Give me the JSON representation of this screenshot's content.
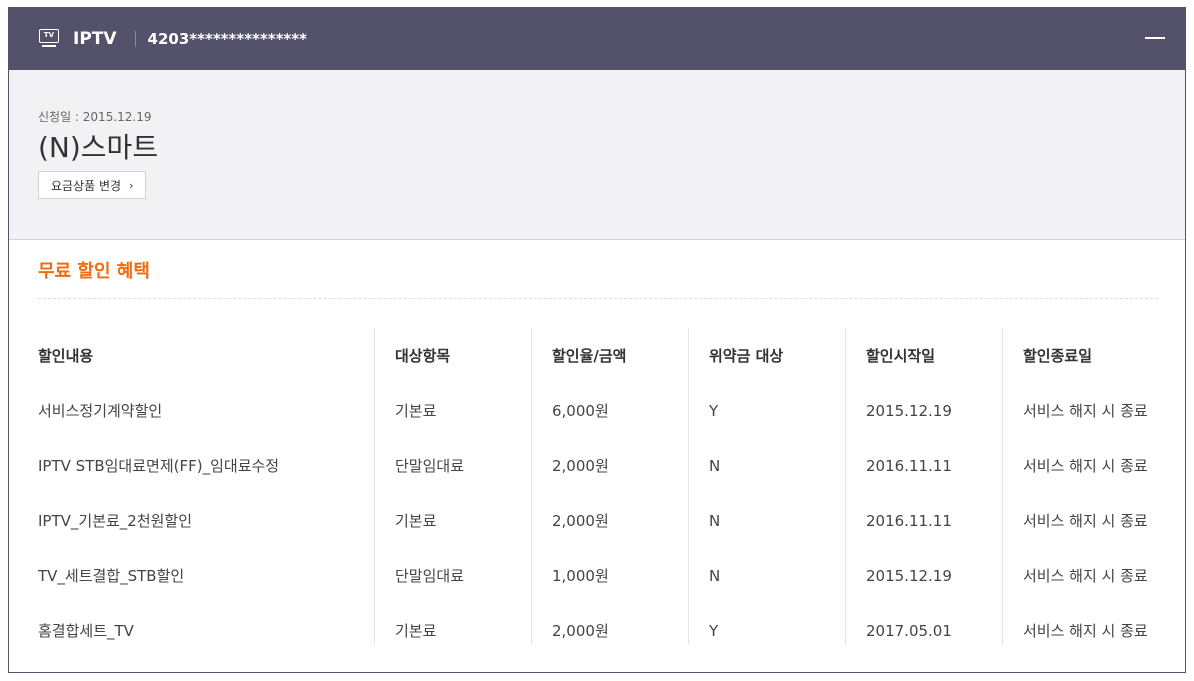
{
  "header": {
    "tv_icon_label": "TV",
    "service_name": "IPTV",
    "account_number": "4203***************"
  },
  "plan": {
    "apply_date": "신청일 : 2015.12.19",
    "name": "(N)스마트",
    "change_button_label": "요금상품 변경",
    "change_button_chevron": "›"
  },
  "benefits": {
    "title": "무료 할인 혜택",
    "columns": [
      "할인내용",
      "대상항목",
      "할인율/금액",
      "위약금 대상",
      "할인시작일",
      "할인종료일"
    ],
    "rows": [
      [
        "서비스정기계약할인",
        "기본료",
        "6,000원",
        "Y",
        "2015.12.19",
        "서비스 해지 시 종료"
      ],
      [
        "IPTV STB임대료면제(FF)_임대료수정",
        "단말임대료",
        "2,000원",
        "N",
        "2016.11.11",
        "서비스 해지 시 종료"
      ],
      [
        "IPTV_기본료_2천원할인",
        "기본료",
        "2,000원",
        "N",
        "2016.11.11",
        "서비스 해지 시 종료"
      ],
      [
        "TV_세트결합_STB할인",
        "단말임대료",
        "1,000원",
        "N",
        "2015.12.19",
        "서비스 해지 시 종료"
      ],
      [
        "홈결합세트_TV",
        "기본료",
        "2,000원",
        "Y",
        "2017.05.01",
        "서비스 해지 시 종료"
      ]
    ]
  },
  "colors": {
    "header_bg": "#54526a",
    "accent_orange": "#ef6c0e",
    "plan_bg": "#f2f2f5"
  }
}
